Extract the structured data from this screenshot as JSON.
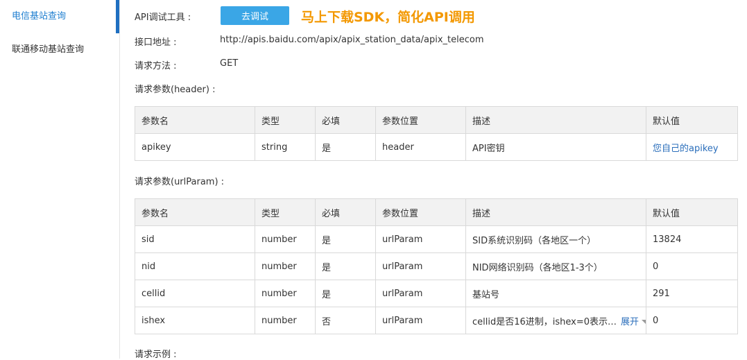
{
  "sidebar": {
    "items": [
      {
        "label": "电信基站查询",
        "active": true
      },
      {
        "label": "联通移动基站查询",
        "active": false
      }
    ]
  },
  "api_tool": {
    "label": "API调试工具 :",
    "button_label": "去调试",
    "promo": "马上下载SDK，简化API调用"
  },
  "endpoint": {
    "label": "接口地址 :",
    "value": "http://apis.baidu.com/apix/apix_station_data/apix_telecom"
  },
  "method": {
    "label": "请求方法 :",
    "value": "GET"
  },
  "header_params": {
    "title": "请求参数(header) :",
    "columns": [
      "参数名",
      "类型",
      "必填",
      "参数位置",
      "描述",
      "默认值"
    ],
    "rows": [
      [
        "apikey",
        "string",
        "是",
        "header",
        "API密钥",
        "您自己的apikey"
      ]
    ]
  },
  "url_params": {
    "title": "请求参数(urlParam) :",
    "columns": [
      "参数名",
      "类型",
      "必填",
      "参数位置",
      "描述",
      "默认值"
    ],
    "rows": [
      [
        "sid",
        "number",
        "是",
        "urlParam",
        "SID系统识别码（各地区一个）",
        "13824"
      ],
      [
        "nid",
        "number",
        "是",
        "urlParam",
        "NID网络识别码（各地区1-3个）",
        "0"
      ],
      [
        "cellid",
        "number",
        "是",
        "urlParam",
        "基站号",
        "291"
      ],
      [
        "ishex",
        "number",
        "否",
        "urlParam",
        "cellid是否16进制，ishex=0表示…",
        "0"
      ]
    ],
    "expand_label": "展开"
  },
  "request_example": {
    "title": "请求示例 :"
  },
  "colors": {
    "accent": "#3aa6e6",
    "promo": "#f39800",
    "link": "#2a6ebb",
    "active_nav": "#1f6fc1"
  }
}
